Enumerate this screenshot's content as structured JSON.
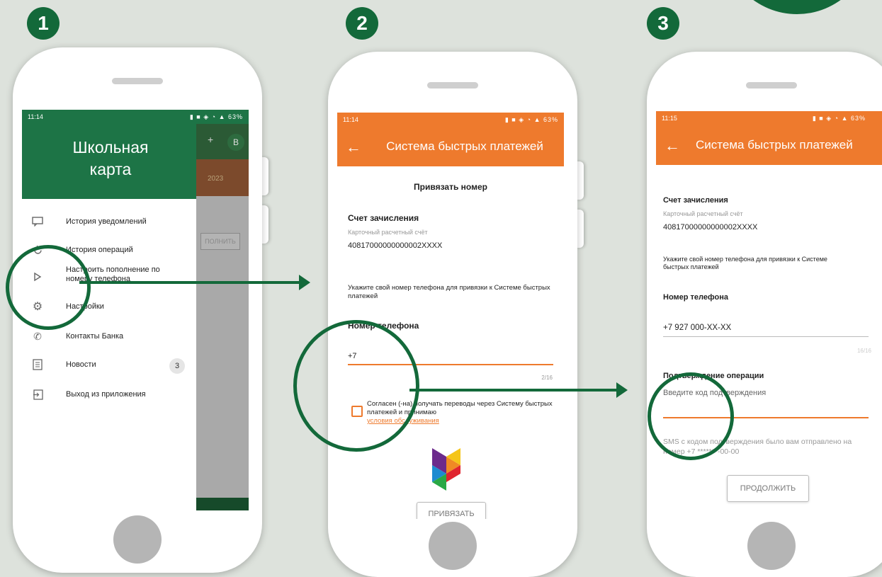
{
  "steps": [
    "1",
    "2",
    "3"
  ],
  "screen1": {
    "status_time": "11:14",
    "status_icons": "▮ ■ ◈ ◔ ▲ 63%",
    "drawer_title": "Школьная карта",
    "bg_avatar": "В",
    "bg_plus": "+",
    "bg_year": "2023",
    "bg_button": "ПОЛНИТЬ",
    "menu": [
      {
        "label": "История уведомлений",
        "icon": "chat-icon"
      },
      {
        "label": "История операций",
        "icon": "history-icon"
      },
      {
        "label": "Настроить пополнение по номеру телефона",
        "icon": "sbp-icon"
      },
      {
        "label": "Настройки",
        "icon": "gear-icon"
      },
      {
        "label": "Контакты Банка",
        "icon": "phone-icon"
      },
      {
        "label": "Новости",
        "icon": "news-icon",
        "badge": "3"
      },
      {
        "label": "Выход из приложения",
        "icon": "exit-icon"
      }
    ]
  },
  "screen2": {
    "status_time": "11:14",
    "status_icons": "▮ ■ ◈ ◔ ▲ 63%",
    "appbar_title": "Система быстрых платежей",
    "heading": "Привязать номер",
    "account_label": "Счет зачисления",
    "account_type": "Карточный расчетный счёт",
    "account_number": "40817000000000002XXXX",
    "instruction": "Укажите свой номер телефона для привязки к Системе быстрых платежей",
    "phone_label": "Номер телефона",
    "phone_value": "+7",
    "counter": "2/16",
    "agree_text": "Согласен (-на) получать переводы через Систему быстрых платежей и принимаю",
    "terms_link": "условия обслуживания",
    "button": "ПРИВЯЗАТЬ"
  },
  "screen3": {
    "status_time": "11:15",
    "status_icons": "▮ ■ ◈ ◔ ▲ 63%",
    "appbar_title": "Система быстрых платежей",
    "account_label": "Счет зачисления",
    "account_type": "Карточный расчетный счёт",
    "account_number": "40817000000000002XXXX",
    "instruction": "Укажите свой номер телефона для привязки к Системе быстрых платежей",
    "phone_label": "Номер телефона",
    "phone_value": "+7 927 000-XX-XX",
    "counter": "16/16",
    "confirm_label": "Подтверждение операции",
    "code_placeholder": "Введите код подтверждения",
    "sms_text": "SMS с кодом подтверждения было вам отправлено на номер +7 *******-00-00",
    "button": "ПРОДОЛЖИТЬ"
  },
  "colors": {
    "green": "#13693a",
    "orange": "#ee7a2d",
    "drawer_green": "#1d7446"
  }
}
